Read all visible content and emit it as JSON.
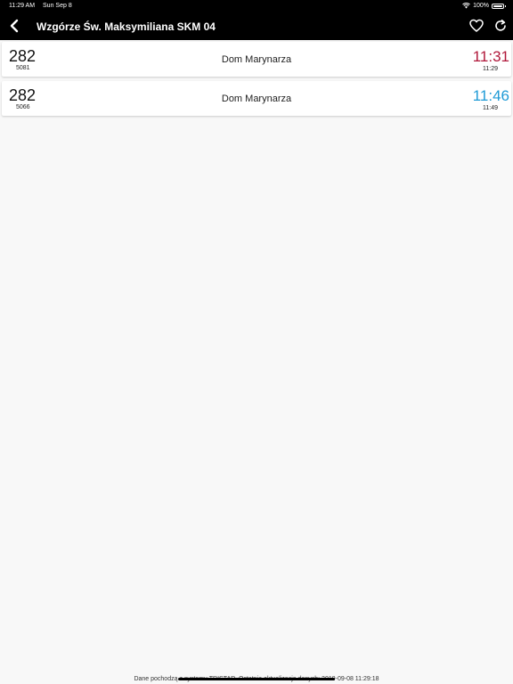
{
  "status_bar": {
    "time": "11:29 AM",
    "date": "Sun Sep 8",
    "battery": "100%"
  },
  "nav": {
    "title": "Wzgórze Św. Maksymiliana SKM 04",
    "icons": {
      "back": "chevron-left-icon",
      "favorite": "heart-icon",
      "refresh": "refresh-icon"
    }
  },
  "departures": [
    {
      "line": "282",
      "vehicle": "5081",
      "direction": "Dom Marynarza",
      "estimated": "11:31",
      "scheduled": "11:29",
      "color": "#b0173a"
    },
    {
      "line": "282",
      "vehicle": "5066",
      "direction": "Dom Marynarza",
      "estimated": "11:46",
      "scheduled": "11:49",
      "color": "#1e9ad6"
    }
  ],
  "footer": {
    "text": "Dane pochodzą z systemu TRISTAR. Ostatnia aktualizacja danych: 2019-09-08 11:29:18"
  }
}
